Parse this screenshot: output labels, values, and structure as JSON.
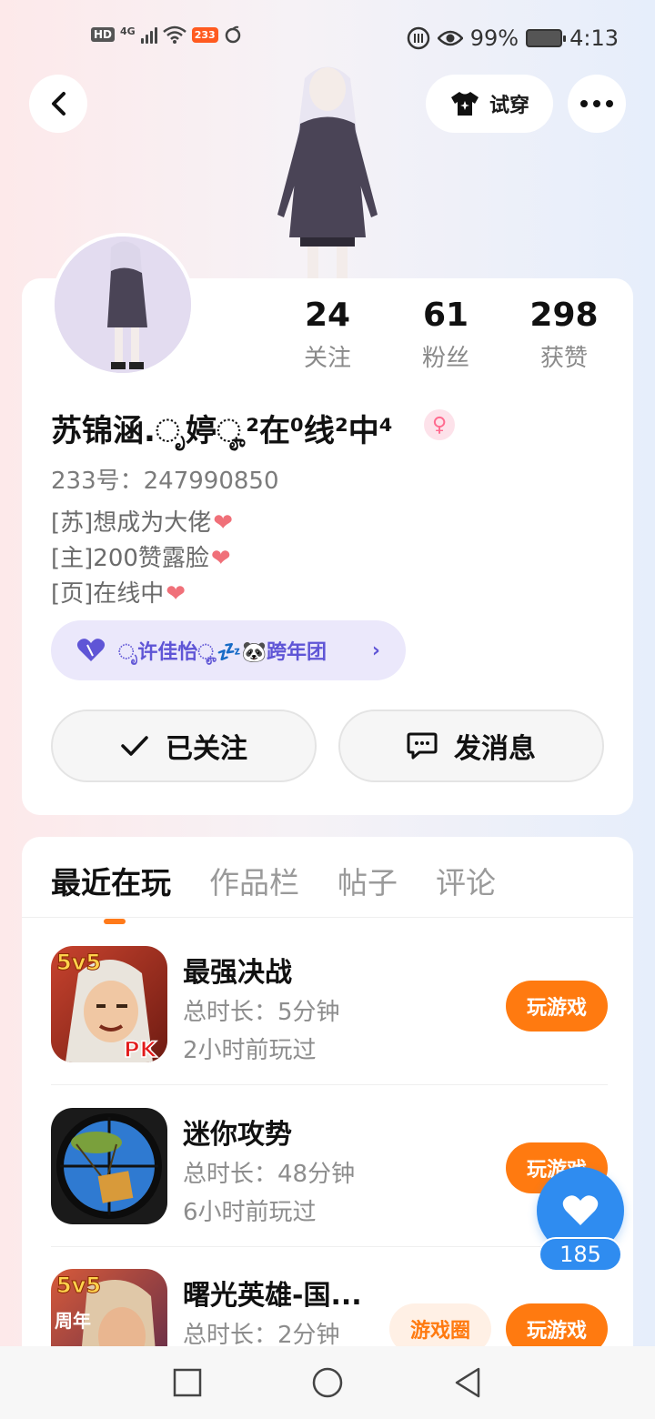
{
  "status_bar": {
    "hd": "HD",
    "network": "4G",
    "app_badge": "233",
    "battery_percent": "99%",
    "time": "4:13"
  },
  "header": {
    "try_on_label": "试穿"
  },
  "profile": {
    "stats": [
      {
        "value": "24",
        "label": "关注"
      },
      {
        "value": "61",
        "label": "粉丝"
      },
      {
        "value": "298",
        "label": "获赞"
      }
    ],
    "username": "苏锦涵.ೃ婷ೄ²在⁰线²中⁴",
    "gender_symbol": "♀",
    "id_label": "233号：",
    "id_value": "247990850",
    "bio": [
      "[苏]想成为大佬",
      "[主]200赞露脸",
      "[页]在线中"
    ],
    "fan_group": "ೃ许佳怡ೄ💤🐼跨年团",
    "follow_label": "已关注",
    "message_label": "发消息"
  },
  "tabs": [
    "最近在玩",
    "作品栏",
    "帖子",
    "评论"
  ],
  "active_tab": 0,
  "games": [
    {
      "name": "最强决战",
      "duration_label": "总时长：",
      "duration": "5分钟",
      "last_played": "2小时前玩过",
      "action": "玩游戏"
    },
    {
      "name": "迷你攻势",
      "duration_label": "总时长：",
      "duration": "48分钟",
      "last_played": "6小时前玩过",
      "action": "玩游戏"
    },
    {
      "name": "曙光英雄-国...",
      "duration_label": "总时长：",
      "duration": "2分钟",
      "circle": "游戏圈",
      "action": "玩游戏"
    }
  ],
  "icon_badges": {
    "game_1_top": "5v5",
    "game_1_bottom": "PK",
    "game_3_top": "5v5",
    "game_3_side": "周年"
  },
  "like_fab": {
    "count": "185"
  },
  "colors": {
    "accent": "#ff7a10",
    "like_blue": "#2f8cf0",
    "fan_group": "#5f55d6"
  }
}
